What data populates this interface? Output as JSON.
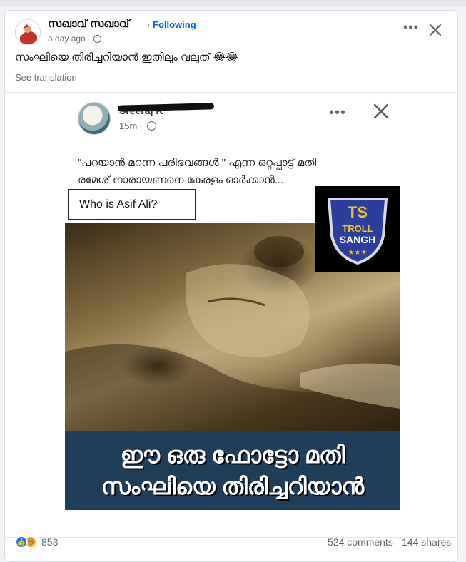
{
  "post": {
    "author": "സഖാവ് സഖാവ്",
    "separator": "·",
    "follow_label": "Following",
    "time": "a day ago",
    "time_sep": "·",
    "caption": "സംഘിയെ തിരിച്ചറിയാൻ ഇതിലും വലുത് 😂😂",
    "see_translation": "See translation",
    "more_icon": "more-options-icon",
    "close_icon": "close-icon"
  },
  "shared_post": {
    "author": "Sreeraj R",
    "time": "15m",
    "time_sep": "·",
    "text_line1": "\"പറയാൻ മറന്ന പരിഭവങ്ങൾ \" എന്ന ഒറ്റപ്പാട്ട് മതി",
    "text_line2": "രമേശ് നാരായണനെ കേരളം ഓർക്കാൻ....",
    "image": {
      "question": "Who is Asif Ali?",
      "logo_text_top": "TS",
      "logo_text_mid": "TROLL",
      "logo_text_bottom": "SANGH",
      "banner_line1": "ഈ ഒരു ഫോട്ടോ മതി",
      "banner_line2": "സംഘിയെ തിരിച്ചറിയാൻ"
    }
  },
  "footer": {
    "reaction_count": "853",
    "comments": "524 comments",
    "shares": "144 shares"
  },
  "colors": {
    "link_blue": "#0064d1",
    "meta_gray": "#65676b",
    "banner_blue": "#1f3e5a"
  }
}
